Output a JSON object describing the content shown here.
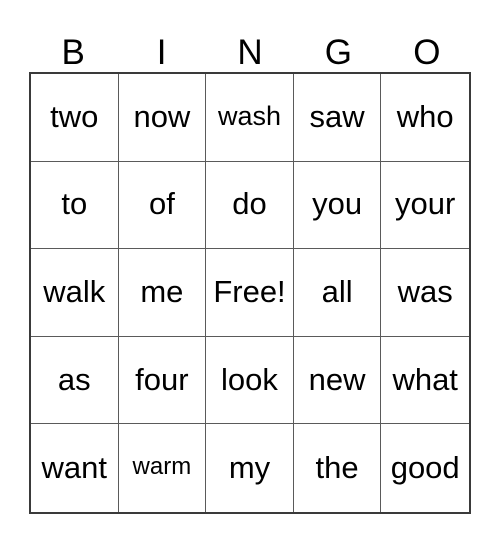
{
  "card": {
    "title": "BINGO",
    "free_space_label": "Free!",
    "columns": 5,
    "rows": 5,
    "grid_line_color": "#5a5a5a",
    "border_color": "#3a3a3a",
    "background_color": "#ffffff",
    "text_color": "#000000"
  },
  "header": {
    "letters": [
      "B",
      "I",
      "N",
      "G",
      "O"
    ]
  },
  "grid": {
    "rows": [
      {
        "cells": [
          {
            "text": "two",
            "size": "normal",
            "free": false
          },
          {
            "text": "now",
            "size": "normal",
            "free": false
          },
          {
            "text": "wash",
            "size": "small",
            "free": false
          },
          {
            "text": "saw",
            "size": "normal",
            "free": false
          },
          {
            "text": "who",
            "size": "normal",
            "free": false
          }
        ]
      },
      {
        "cells": [
          {
            "text": "to",
            "size": "normal",
            "free": false
          },
          {
            "text": "of",
            "size": "normal",
            "free": false
          },
          {
            "text": "do",
            "size": "normal",
            "free": false
          },
          {
            "text": "you",
            "size": "normal",
            "free": false
          },
          {
            "text": "your",
            "size": "normal",
            "free": false
          }
        ]
      },
      {
        "cells": [
          {
            "text": "walk",
            "size": "normal",
            "free": false
          },
          {
            "text": "me",
            "size": "normal",
            "free": false
          },
          {
            "text": "Free!",
            "size": "normal",
            "free": true
          },
          {
            "text": "all",
            "size": "normal",
            "free": false
          },
          {
            "text": "was",
            "size": "normal",
            "free": false
          }
        ]
      },
      {
        "cells": [
          {
            "text": "as",
            "size": "normal",
            "free": false
          },
          {
            "text": "four",
            "size": "normal",
            "free": false
          },
          {
            "text": "look",
            "size": "normal",
            "free": false
          },
          {
            "text": "new",
            "size": "normal",
            "free": false
          },
          {
            "text": "what",
            "size": "normal",
            "free": false
          }
        ]
      },
      {
        "cells": [
          {
            "text": "want",
            "size": "normal",
            "free": false
          },
          {
            "text": "warm",
            "size": "tiny",
            "free": false
          },
          {
            "text": "my",
            "size": "normal",
            "free": false
          },
          {
            "text": "the",
            "size": "normal",
            "free": false
          },
          {
            "text": "good",
            "size": "normal",
            "free": false
          }
        ]
      }
    ]
  }
}
